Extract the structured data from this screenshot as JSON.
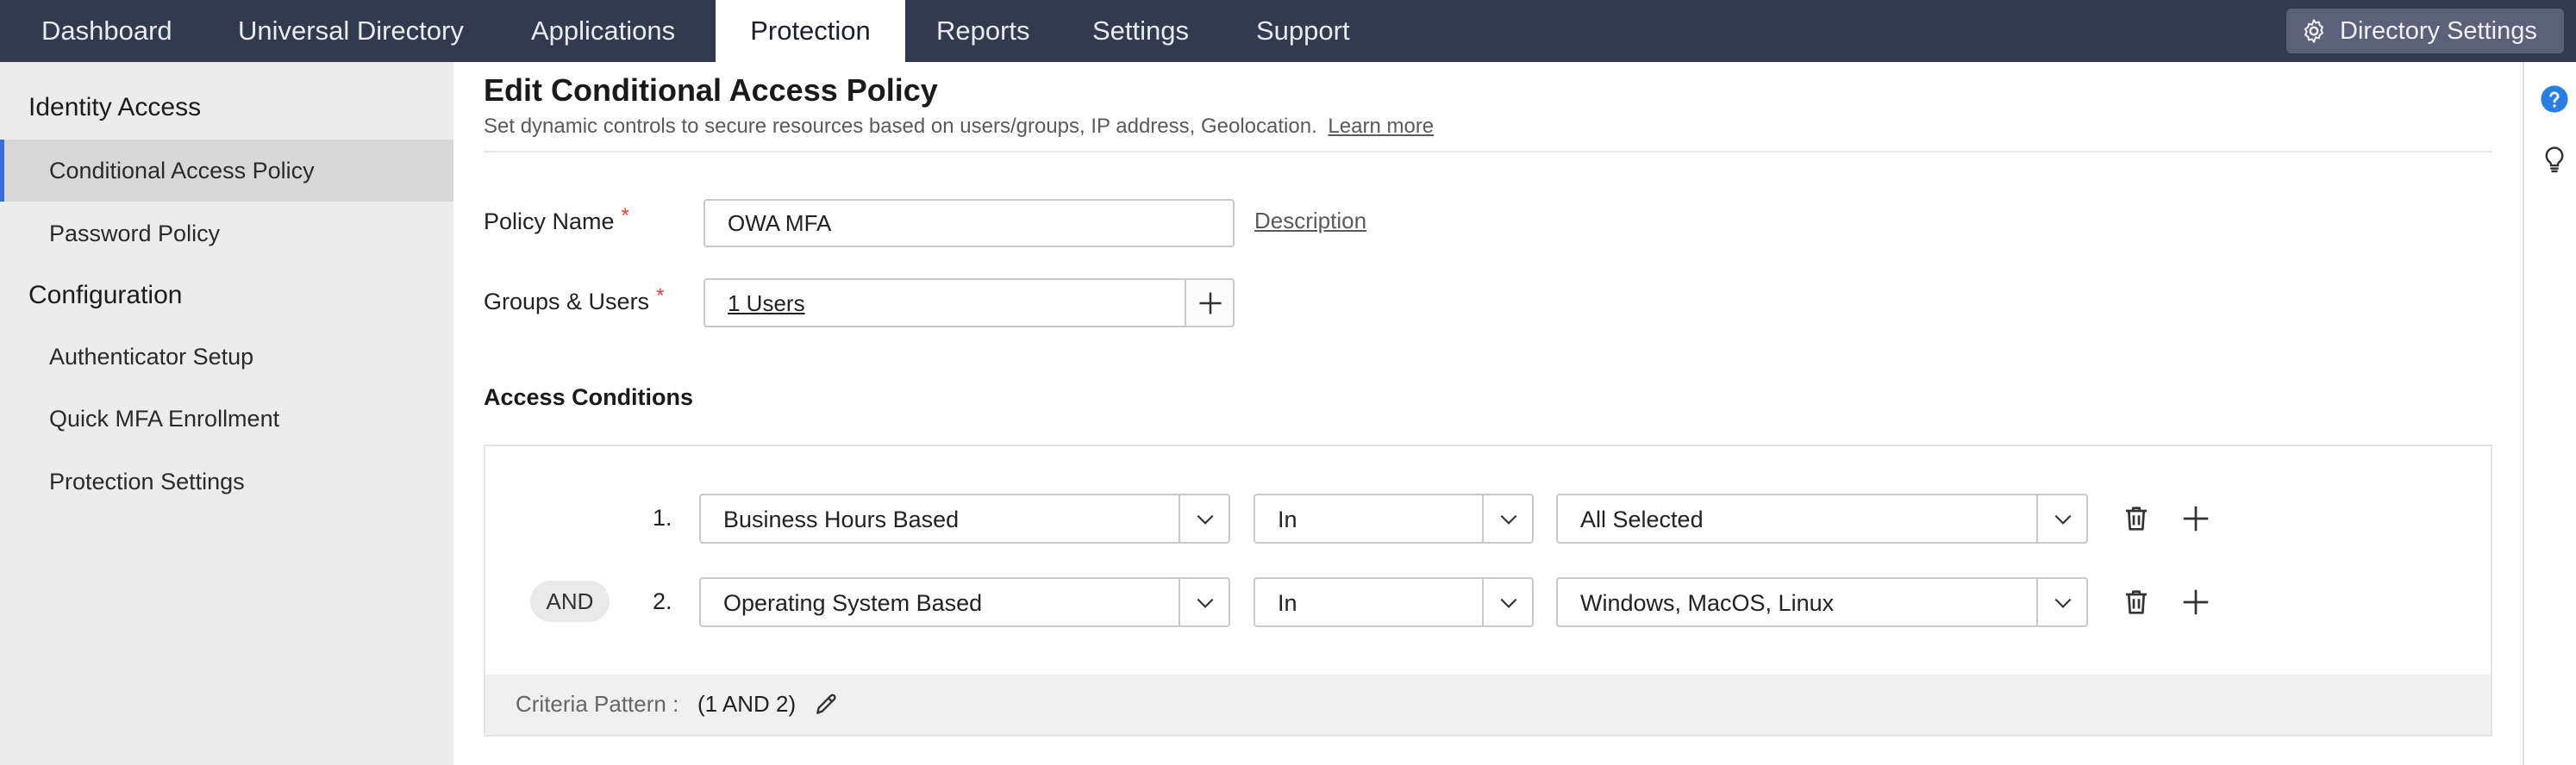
{
  "topnav": {
    "items": [
      {
        "label": "Dashboard"
      },
      {
        "label": "Universal Directory"
      },
      {
        "label": "Applications"
      },
      {
        "label": "Protection"
      },
      {
        "label": "Reports"
      },
      {
        "label": "Settings"
      },
      {
        "label": "Support"
      }
    ],
    "active": "Protection",
    "directory_settings_label": "Directory Settings"
  },
  "sidebar": {
    "section_identity": "Identity Access",
    "identity_items": [
      {
        "label": "Conditional Access Policy"
      },
      {
        "label": "Password Policy"
      }
    ],
    "section_config": "Configuration",
    "config_items": [
      {
        "label": "Authenticator Setup"
      },
      {
        "label": "Quick MFA Enrollment"
      },
      {
        "label": "Protection Settings"
      }
    ],
    "active_item": "Conditional Access Policy"
  },
  "page": {
    "title": "Edit Conditional Access Policy",
    "subtitle": "Set dynamic controls to secure resources based on users/groups, IP address, Geolocation.",
    "learn_more": "Learn more"
  },
  "form": {
    "policy_name_label": "Policy Name",
    "policy_name_value": "OWA MFA",
    "required_mark": "*",
    "description_link": "Description",
    "groups_users_label": "Groups & Users",
    "groups_users_value": "1 Users"
  },
  "conditions": {
    "heading": "Access Conditions",
    "and_label": "AND",
    "rows": [
      {
        "number": "1.",
        "type": "Business Hours Based",
        "operator": "In",
        "value": "All Selected"
      },
      {
        "number": "2.",
        "type": "Operating System Based",
        "operator": "In",
        "value": "Windows, MacOS, Linux"
      }
    ],
    "criteria_label": "Criteria Pattern :",
    "criteria_value": "(1 AND 2)"
  },
  "colors": {
    "topbar_bg": "#323a4f",
    "active_accent": "#3a6fd8",
    "required": "#d9443c",
    "help_icon": "#2a7de1"
  }
}
